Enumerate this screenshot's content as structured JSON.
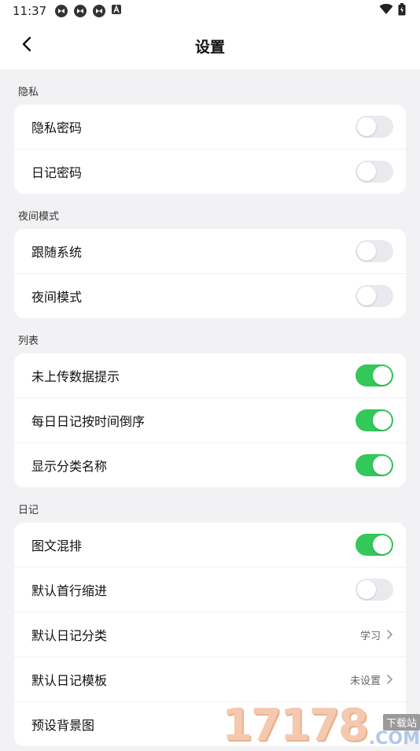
{
  "status_bar": {
    "time": "11:37",
    "left_icons": [
      "settings-sync-icon",
      "settings-sync-icon",
      "settings-sync-icon",
      "a-icon"
    ],
    "right_icons": [
      "wifi-icon",
      "battery-icon"
    ]
  },
  "header": {
    "title": "设置"
  },
  "sections": [
    {
      "title": "隐私",
      "rows": [
        {
          "label": "隐私密码",
          "type": "toggle",
          "on": false
        },
        {
          "label": "日记密码",
          "type": "toggle",
          "on": false
        }
      ]
    },
    {
      "title": "夜间模式",
      "rows": [
        {
          "label": "跟随系统",
          "type": "toggle",
          "on": false
        },
        {
          "label": "夜间模式",
          "type": "toggle",
          "on": false
        }
      ]
    },
    {
      "title": "列表",
      "rows": [
        {
          "label": "未上传数据提示",
          "type": "toggle",
          "on": true
        },
        {
          "label": "每日日记按时间倒序",
          "type": "toggle",
          "on": true
        },
        {
          "label": "显示分类名称",
          "type": "toggle",
          "on": true
        }
      ]
    },
    {
      "title": "日记",
      "rows": [
        {
          "label": "图文混排",
          "type": "toggle",
          "on": true
        },
        {
          "label": "默认首行缩进",
          "type": "toggle",
          "on": false
        },
        {
          "label": "默认日记分类",
          "type": "value",
          "value": "学习"
        },
        {
          "label": "默认日记模板",
          "type": "value",
          "value": "未设置"
        },
        {
          "label": "预设背景图",
          "type": "value",
          "value": ""
        }
      ]
    }
  ],
  "watermark": {
    "number": "17178",
    "tag": "下载站",
    "suffix": ".COM"
  },
  "colors": {
    "toggle_on": "#34c759",
    "toggle_off": "#e9e9ee",
    "background": "#f2f2f4"
  }
}
